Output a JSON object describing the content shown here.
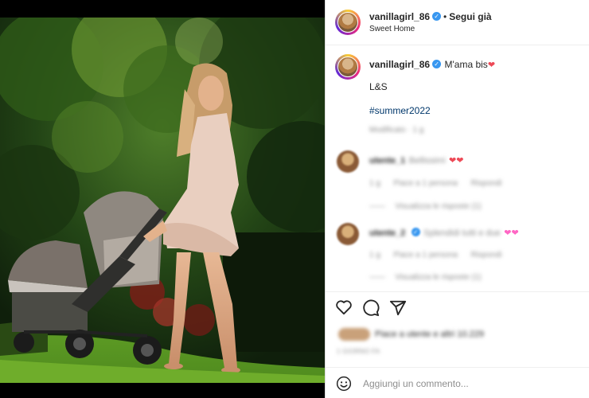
{
  "header": {
    "username": "vanillagirl_86",
    "separator": "•",
    "follow_label": "Segui già",
    "location": "Sweet Home"
  },
  "caption": {
    "username": "vanillagirl_86",
    "text": "M'ama bis",
    "line2": "L&S",
    "hashtag": "#summer2022",
    "time": "Modificato · 1 g"
  },
  "comments": [
    {
      "username": "utente_1",
      "text": "Bellissimi",
      "meta_time": "1 g",
      "meta_likes": "Piace a 1 persona",
      "meta_reply": "Rispondi",
      "view_replies": "Visualizza le risposte (1)"
    },
    {
      "username": "utente_2",
      "text": "Splendidi tutti e due",
      "meta_time": "1 g",
      "meta_likes": "Piace a 1 persona",
      "meta_reply": "Rispondi",
      "view_replies": "Visualizza le risposte (1)"
    }
  ],
  "likes_text": "Piace a utente e altri 10.229",
  "post_time": "1 GIORNO FA",
  "add_comment": {
    "placeholder": "Aggiungi un commento..."
  },
  "icons": {
    "like": "heart-outline-icon",
    "comment": "speech-bubble-icon",
    "share": "paper-plane-icon",
    "emoji": "smiley-icon",
    "verified": "verified-badge-icon"
  },
  "colors": {
    "verified": "#3897f0",
    "hashtag": "#00376b",
    "heart": "#ed4956"
  }
}
